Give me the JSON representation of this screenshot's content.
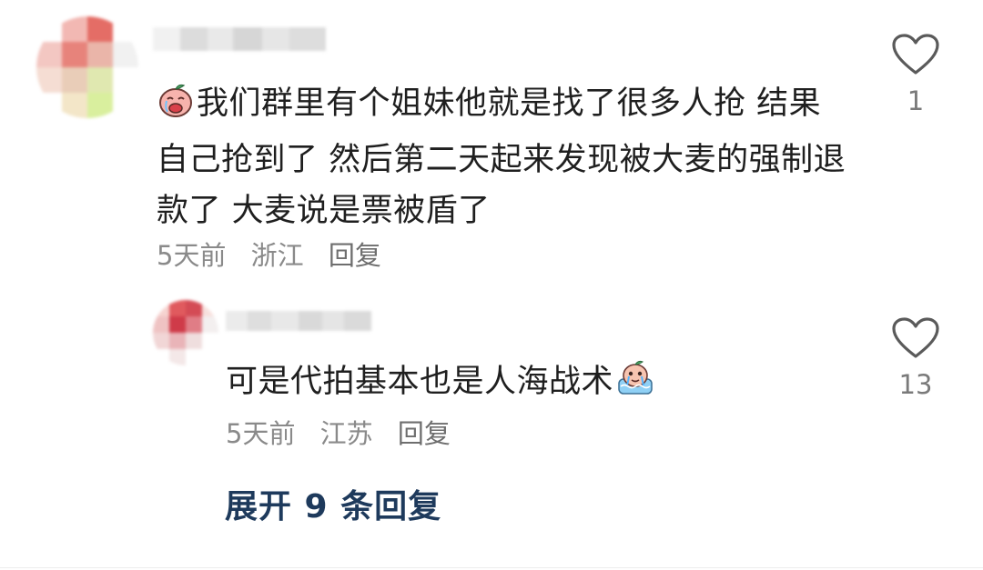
{
  "comments": [
    {
      "text": "我们群里有个姐妹他就是找了很多人抢 结果自己抢到了 然后第二天起来发现被大麦的强制退款了 大麦说是票被盾了",
      "emoji": "crying-peach-emoji",
      "time": "5天前",
      "location": "浙江",
      "reply_label": "回复",
      "likes": "1"
    },
    {
      "text": "可是代拍基本也是人海战术",
      "emoji": "crying-bath-emoji",
      "time": "5天前",
      "location": "江苏",
      "reply_label": "回复",
      "likes": "13"
    }
  ],
  "expand_label": "展开 9 条回复",
  "colors": {
    "text": "#1f1f1f",
    "meta": "#8a8a8a",
    "expand": "#1e3a5c",
    "heart_outline": "#5a5a5a"
  }
}
